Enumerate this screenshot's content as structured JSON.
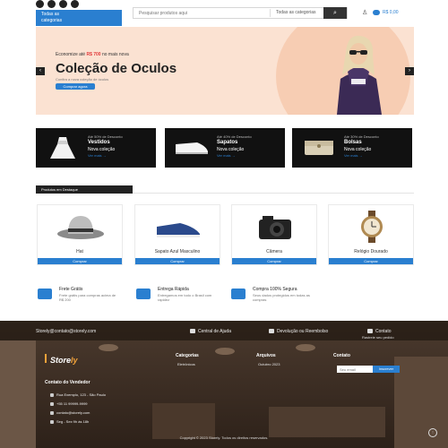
{
  "header": {
    "categories_label": "Todas as\ncategorias",
    "search_placeholder": "Pesquisar produtos aqui",
    "search_category": "Todas as categorias",
    "cart_total": "R$ 0,00"
  },
  "hero": {
    "subtitle_prefix": "Economize até",
    "subtitle_price": "R$ 700",
    "subtitle_suffix": "no mais nova",
    "title": "Coleção de Oculos",
    "description": "Confira a nova coleção de óculos",
    "cta": "Comprar agora",
    "prev": "‹",
    "next": "›"
  },
  "category_cards": [
    {
      "caption": "Até 50% de Desconto",
      "title": "Vestidos",
      "subtitle": "Nova coleção",
      "link": "Ver mais →"
    },
    {
      "caption": "Até 40% de Desconto",
      "title": "Sapatos",
      "subtitle": "Nova coleção",
      "link": "Ver mais →"
    },
    {
      "caption": "Até 30% de Desconto",
      "title": "Bolsas",
      "subtitle": "Nova coleção",
      "link": "Ver mais →"
    }
  ],
  "featured": {
    "title": "Produtos em Destaque",
    "prev": "‹",
    "next": "›",
    "products": [
      {
        "name": "Hat",
        "button": "Comprar"
      },
      {
        "name": "Sapato Azul Masculino",
        "button": "Comprar"
      },
      {
        "name": "Câmera",
        "button": "Comprar"
      },
      {
        "name": "Relógio Dourado",
        "button": "Comprar"
      }
    ]
  },
  "features": [
    {
      "title": "Frete Grátis",
      "text": "Frete grátis para compras acima de R$ 200"
    },
    {
      "title": "Entrega Rápida",
      "text": "Entregamos em todo o Brasil com rapidez"
    },
    {
      "title": "Compra 100% Segura",
      "text": "Seus dados protegidos em todas as compras"
    }
  ],
  "footer": {
    "email": "Storely@contato@storely.com",
    "links": [
      "Central de Ajuda",
      "Devolução ou Reembolso",
      "Contato"
    ],
    "track_order": "Rastreie seu pedido",
    "logo_main": "Store",
    "logo_accent": "ly",
    "columns": [
      {
        "heading": "Categorias",
        "item": "Eletrônicos"
      },
      {
        "heading": "Arquivos",
        "item": "Outubro 2023"
      },
      {
        "heading": "Contato",
        "item": ""
      }
    ],
    "newsletter_placeholder": "Seu email",
    "newsletter_button": "Inscrever",
    "contact_heading": "Contato do Vendedor",
    "contact_lines": [
      "Rua Exemplo, 123 - São Paulo",
      "+55 11 99999-9999",
      "contato@storely.com",
      "Seg - Sex 9h às 18h"
    ],
    "copyright": "Copyright © 2023 Storely. Todos os direitos reservados.",
    "to_top": "↑"
  }
}
